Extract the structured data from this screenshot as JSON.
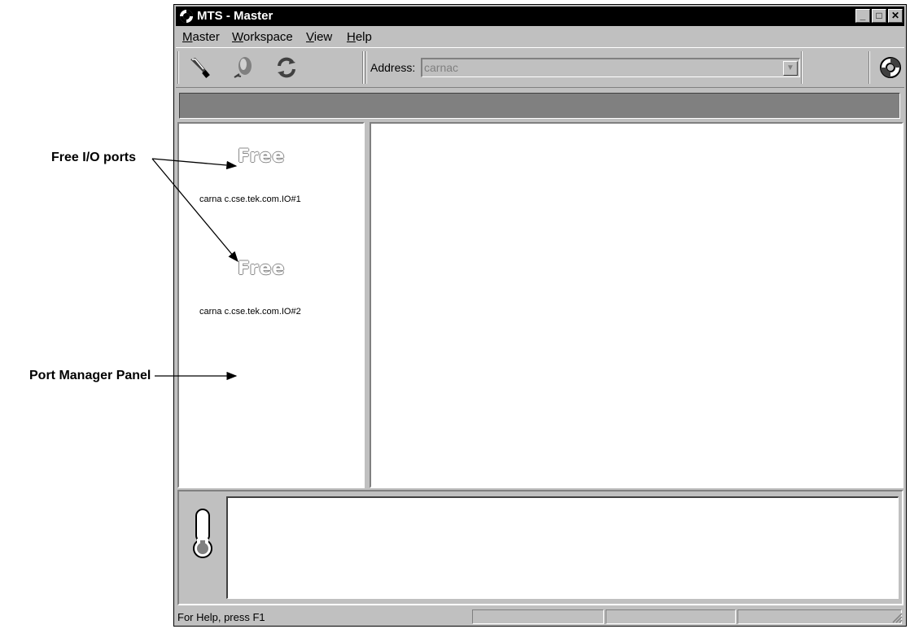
{
  "window": {
    "title": "MTS - Master",
    "minimize": "_",
    "maximize": "□",
    "close": "✕"
  },
  "menubar": {
    "items": [
      {
        "accel": "M",
        "rest": "aster"
      },
      {
        "accel": "W",
        "rest": "orkspace"
      },
      {
        "accel": "V",
        "rest": "iew"
      },
      {
        "accel": "H",
        "rest": "elp"
      }
    ]
  },
  "toolbar": {
    "buttons": [
      "connect-icon",
      "leaf-icon",
      "refresh-icon"
    ],
    "address_label": "Address:",
    "address_value": "carnac",
    "help_button": "lifebuoy-icon"
  },
  "port_manager": {
    "ports": [
      {
        "status": "Free",
        "host": "carna c.cse.tek.com.IO#1"
      },
      {
        "status": "Free",
        "host": "carna c.cse.tek.com.IO#2"
      }
    ]
  },
  "log_panel": {
    "icon": "thermometer-icon"
  },
  "statusbar": {
    "text": "For Help, press F1"
  },
  "callouts": {
    "free_ports": "Free I/O ports",
    "port_manager": "Port Manager Panel"
  }
}
